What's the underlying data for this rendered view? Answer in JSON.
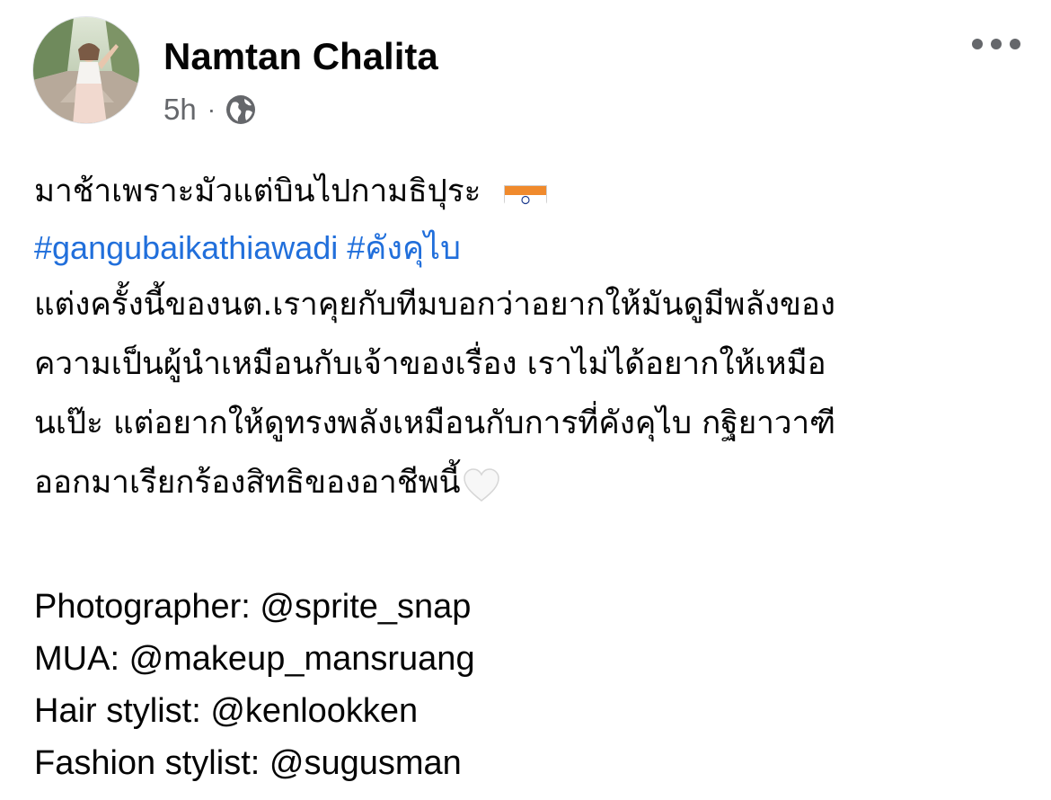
{
  "post": {
    "author": "Namtan Chalita",
    "timestamp": "5h",
    "separator": "·",
    "audience_icon": "globe-icon",
    "more_icon": "more-options-icon",
    "text": {
      "line1": "มาช้าเพราะมัวแต่บินไปกามธิปุระ",
      "line1_emoji": "india-flag-emoji",
      "hashtags": [
        "#gangubaikathiawadi",
        "#คังคุไบ"
      ],
      "paragraph_lines": [
        "แต่งครั้งนี้ของนต.เราคุยกับทีมบอกว่าอยากให้มันดูมีพลังของ",
        "ความเป็นผู้นำเหมือนกับเจ้าของเรื่อง เราไม่ได้อยากให้เหมือ",
        "นเป๊ะ แต่อยากให้ดูทรงพลังเหมือนกับการที่คังคุไบ กฐิยาวาฑี",
        "ออกมาเรียกร้องสิทธิของอาชีพนี้"
      ],
      "paragraph_end_emoji": "white-heart-emoji"
    },
    "credits": [
      {
        "label": "Photographer: ",
        "handle": "@sprite_snap"
      },
      {
        "label": "MUA: ",
        "handle": "@makeup_mansruang"
      },
      {
        "label": "Hair stylist: ",
        "handle": "@kenlookken"
      },
      {
        "label": "Fashion stylist: ",
        "handle": "@sugusman"
      }
    ]
  },
  "colors": {
    "hashtag": "#216fdb",
    "meta_text": "#65676b",
    "primary_text": "#050505",
    "background": "#ffffff"
  }
}
